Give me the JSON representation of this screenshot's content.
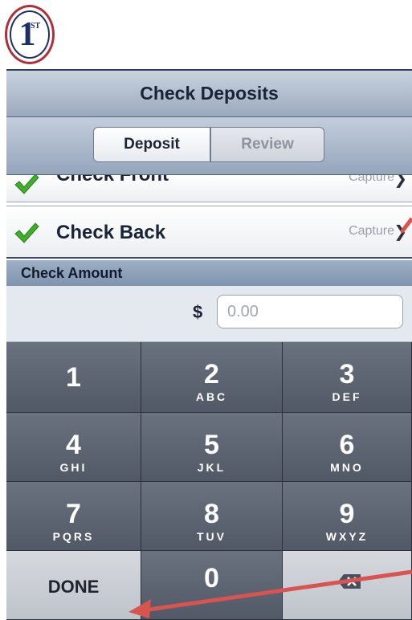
{
  "app": {
    "logo_text": "1",
    "logo_superscript": "ST"
  },
  "header": {
    "title": "Check Deposits"
  },
  "tabs": [
    {
      "label": "Deposit",
      "selected": true
    },
    {
      "label": "Review",
      "selected": false
    }
  ],
  "rows": [
    {
      "label": "Check Front",
      "action": "Capture",
      "checked": true
    },
    {
      "label": "Check Back",
      "action": "Capture",
      "checked": true
    }
  ],
  "amount": {
    "section_title": "Check Amount",
    "currency": "$",
    "placeholder": "0.00",
    "value": ""
  },
  "keypad": {
    "keys": [
      {
        "digit": "1",
        "letters": ""
      },
      {
        "digit": "2",
        "letters": "ABC"
      },
      {
        "digit": "3",
        "letters": "DEF"
      },
      {
        "digit": "4",
        "letters": "GHI"
      },
      {
        "digit": "5",
        "letters": "JKL"
      },
      {
        "digit": "6",
        "letters": "MNO"
      },
      {
        "digit": "7",
        "letters": "PQRS"
      },
      {
        "digit": "8",
        "letters": "TUV"
      },
      {
        "digit": "9",
        "letters": "WXYZ"
      }
    ],
    "done_label": "DONE",
    "zero": "0",
    "backspace_icon": "backspace-icon"
  },
  "colors": {
    "annotation_arrow": "#d9534f",
    "check_green": "#3fae2a",
    "nav_blue": "#1b2437"
  }
}
